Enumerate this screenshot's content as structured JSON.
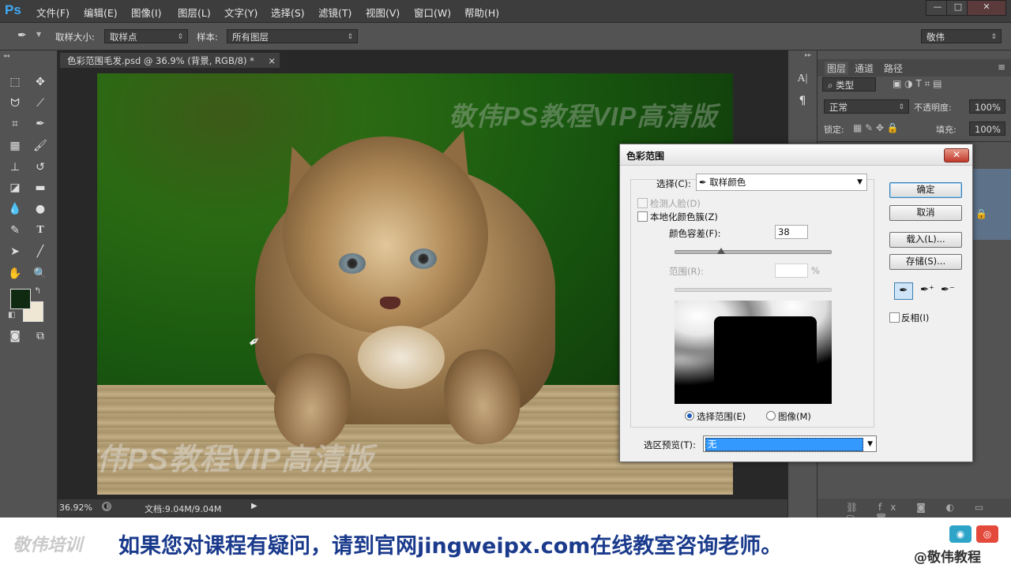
{
  "app": {
    "logo": "Ps"
  },
  "menu": [
    "文件(F)",
    "编辑(E)",
    "图像(I)",
    "图层(L)",
    "文字(Y)",
    "选择(S)",
    "滤镜(T)",
    "视图(V)",
    "窗口(W)",
    "帮助(H)"
  ],
  "window_controls": {
    "minimize": "—",
    "restore": "□",
    "close": "✕"
  },
  "options": {
    "sample_size_label": "取样大小:",
    "sample_size_value": "取样点",
    "sample_label": "样本:",
    "sample_value": "所有图层",
    "workspace": "敬伟"
  },
  "document": {
    "tab_title": "色彩范围毛发.psd @ 36.9% (背景, RGB/8) *",
    "close": "×",
    "zoom": "36.92%",
    "doc_info": "文档:9.04M/9.04M",
    "watermark": "敬伟PS教程VIP高清版"
  },
  "layers_panel": {
    "tabs": [
      "图层",
      "通道",
      "路径"
    ],
    "filter_kind": "类型",
    "blend_mode": "正常",
    "opacity_label": "不透明度:",
    "opacity_value": "100%",
    "lock_label": "锁定:",
    "fill_label": "填充:",
    "fill_value": "100%"
  },
  "dialog": {
    "title": "色彩范围",
    "close": "✕",
    "select_label": "选择(C):",
    "select_value": "取样颜色",
    "detect_faces": "检测人脸(D)",
    "localized": "本地化颜色簇(Z)",
    "fuzziness_label": "颜色容差(F):",
    "fuzziness_value": "38",
    "fuzziness_level": 0.3,
    "range_label": "范围(R):",
    "range_unit": "%",
    "radio_selection": "选择范围(E)",
    "radio_image": "图像(M)",
    "preview_label": "选区预览(T):",
    "preview_value": "无",
    "ok": "确定",
    "cancel": "取消",
    "load": "载入(L)...",
    "save": "存储(S)...",
    "invert": "反相(I)"
  },
  "banner": {
    "logo": "敬伟培训",
    "message": "如果您对课程有疑问，请到官网jingweipx.com在线教室咨询老师。",
    "weibo": "@敬伟教程"
  },
  "colors": {
    "accent": "#3fa9f5",
    "banner_text": "#1a3a8c",
    "selection_blue": "#3399ff"
  }
}
